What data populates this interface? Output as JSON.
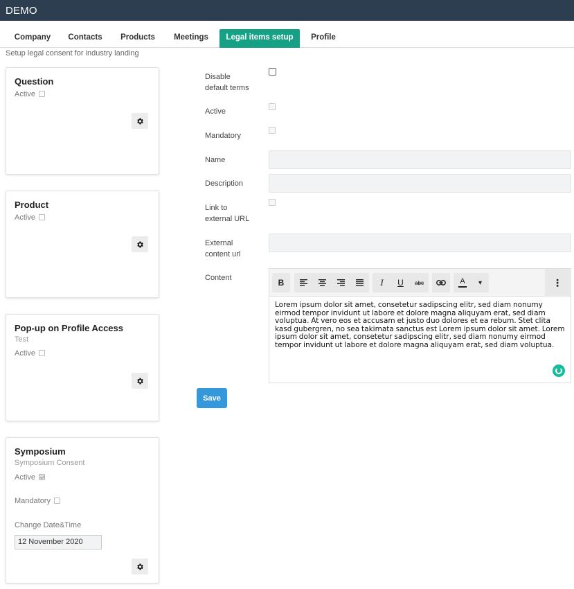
{
  "app": {
    "title": "DEMO"
  },
  "tabs": [
    {
      "label": "Company"
    },
    {
      "label": "Contacts"
    },
    {
      "label": "Products"
    },
    {
      "label": "Meetings"
    },
    {
      "label": "Legal items setup",
      "active": true
    },
    {
      "label": "Profile"
    }
  ],
  "page": {
    "subtitle": "Setup legal consent for industry landing"
  },
  "cards": [
    {
      "title": "Question",
      "active_label": "Active",
      "active_checked": false
    },
    {
      "title": "Product",
      "active_label": "Active",
      "active_checked": false
    },
    {
      "title": "Pop-up on Profile Access",
      "subtitle": "Test",
      "active_label": "Active",
      "active_checked": false
    },
    {
      "title": "Symposium",
      "subtitle": "Symposium Consent",
      "active_label": "Active",
      "active_checked": true,
      "mandatory_label": "Mandatory",
      "mandatory_checked": false,
      "change_label": "Change Date&Time",
      "date_value": "12 November 2020"
    }
  ],
  "form": {
    "disable_default_terms": {
      "label_line1": "Disable",
      "label_line2": "default terms",
      "checked": false
    },
    "active": {
      "label": "Active",
      "checked": false
    },
    "mandatory": {
      "label": "Mandatory",
      "checked": false
    },
    "name": {
      "label": "Name",
      "value": ""
    },
    "description": {
      "label": "Description",
      "value": ""
    },
    "link_external": {
      "label_line1": "Link to",
      "label_line2": "external URL",
      "checked": false
    },
    "external_content_url": {
      "label_line1": "External",
      "label_line2": "content url",
      "value": ""
    },
    "content": {
      "label": "Content",
      "text": "Lorem ipsum dolor sit amet, consetetur sadipscing elitr, sed diam nonumy eirmod tempor invidunt ut labore et dolore magna aliquyam erat, sed diam voluptua. At vero eos et accusam et justo duo dolores et ea rebum. Stet clita kasd gubergren, no sea takimata sanctus est Lorem ipsum dolor sit amet. Lorem ipsum dolor sit amet, consetetur sadipscing elitr, sed diam nonumy eirmod tempor invidunt ut labore et dolore magna aliquyam erat, sed diam voluptua."
    },
    "toolbar": {
      "bold": "B",
      "italic": "I",
      "underline": "U",
      "strike": "abc",
      "font_color": "A",
      "dropdown": "▾",
      "more": "⋮"
    },
    "save_label": "Save"
  },
  "colors": {
    "header": "#2c3e50",
    "active_tab": "#16a085",
    "primary_button": "#3498db",
    "spinner": "#1abc9c"
  }
}
